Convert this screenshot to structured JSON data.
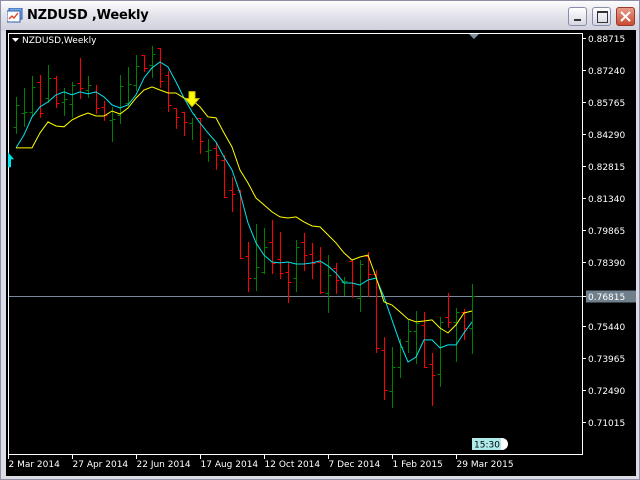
{
  "window": {
    "title": "NZDUSD ,Weekly"
  },
  "chart_header": "NZDUSD,Weekly",
  "timer_label": "15:30",
  "colors": {
    "bull": "#008000",
    "bear": "#ff0000",
    "fast_ma": "#00e5ee",
    "slow_ma": "#ffff00",
    "grid_line": "#778899",
    "background": "#000000",
    "foreground": "#ffffff"
  },
  "chart_data": {
    "type": "bar",
    "subtype": "ohlc",
    "title": "NZDUSD,Weekly",
    "ylim": [
      0.7,
      0.89
    ],
    "y_ticks": [
      "0.88715",
      "0.87240",
      "0.85765",
      "0.84290",
      "0.82815",
      "0.81340",
      "0.79865",
      "0.78390",
      "0.76815",
      "0.75440",
      "0.73965",
      "0.72490",
      "0.71015"
    ],
    "y_tick_values": [
      0.88715,
      0.8724,
      0.85765,
      0.8429,
      0.82815,
      0.8134,
      0.79865,
      0.7839,
      0.76815,
      0.7544,
      0.73965,
      0.7249,
      0.71015
    ],
    "current_price": "0.76815",
    "current_price_value": 0.76815,
    "x_ticks": [
      {
        "label": "2 Mar 2014",
        "bar": -1
      },
      {
        "label": "27 Apr 2014",
        "bar": 7
      },
      {
        "label": "22 Jun 2014",
        "bar": 15
      },
      {
        "label": "17 Aug 2014",
        "bar": 23
      },
      {
        "label": "12 Oct 2014",
        "bar": 31
      },
      {
        "label": "7 Dec 2014",
        "bar": 39
      },
      {
        "label": "1 Feb 2015",
        "bar": 47
      },
      {
        "label": "29 Mar 2015",
        "bar": 55
      }
    ],
    "ohlc": [
      [
        0.8462,
        0.86,
        0.8434,
        0.8563
      ],
      [
        0.8526,
        0.8641,
        0.8466,
        0.8531
      ],
      [
        0.8531,
        0.8697,
        0.8517,
        0.8646
      ],
      [
        0.8669,
        0.8701,
        0.8508,
        0.8526
      ],
      [
        0.8595,
        0.8747,
        0.8577,
        0.8687
      ],
      [
        0.8687,
        0.8697,
        0.8554,
        0.8572
      ],
      [
        0.8577,
        0.8641,
        0.8517,
        0.8591
      ],
      [
        0.8568,
        0.8669,
        0.8508,
        0.8655
      ],
      [
        0.8664,
        0.878,
        0.8595,
        0.8641
      ],
      [
        0.8632,
        0.8697,
        0.86,
        0.8655
      ],
      [
        0.8623,
        0.8655,
        0.8526,
        0.8549
      ],
      [
        0.8554,
        0.8581,
        0.8494,
        0.8517
      ],
      [
        0.8494,
        0.8554,
        0.8397,
        0.8498
      ],
      [
        0.8517,
        0.8701,
        0.848,
        0.8651
      ],
      [
        0.8572,
        0.8738,
        0.8563,
        0.866
      ],
      [
        0.8655,
        0.8793,
        0.8632,
        0.8743
      ],
      [
        0.8793,
        0.8793,
        0.872,
        0.8734
      ],
      [
        0.8747,
        0.8835,
        0.8692,
        0.8798
      ],
      [
        0.8826,
        0.8826,
        0.8646,
        0.8674
      ],
      [
        0.8701,
        0.872,
        0.8535,
        0.8563
      ],
      [
        0.8549,
        0.8549,
        0.8457,
        0.8508
      ],
      [
        0.8531,
        0.8531,
        0.8425,
        0.8485
      ],
      [
        0.848,
        0.8503,
        0.8406,
        0.8521
      ],
      [
        0.8503,
        0.8503,
        0.8342,
        0.8397
      ],
      [
        0.8351,
        0.8406,
        0.8305,
        0.8355
      ],
      [
        0.8365,
        0.8392,
        0.8268,
        0.8332
      ],
      [
        0.8309,
        0.8332,
        0.8139,
        0.8139
      ],
      [
        0.8171,
        0.8231,
        0.8074,
        0.8153
      ],
      [
        0.8171,
        0.8171,
        0.7858,
        0.7858
      ],
      [
        0.7867,
        0.7931,
        0.7705,
        0.7765
      ],
      [
        0.7765,
        0.8014,
        0.771,
        0.7816
      ],
      [
        0.7793,
        0.7996,
        0.7788,
        0.7908
      ],
      [
        0.7931,
        0.8033,
        0.7788,
        0.7835
      ],
      [
        0.7853,
        0.7977,
        0.7765,
        0.7788
      ],
      [
        0.7793,
        0.7839,
        0.7655,
        0.7747
      ],
      [
        0.7765,
        0.7941,
        0.7705,
        0.7908
      ],
      [
        0.7931,
        0.7973,
        0.7802,
        0.7871
      ],
      [
        0.7876,
        0.7927,
        0.7765,
        0.7835
      ],
      [
        0.7839,
        0.7908,
        0.7696,
        0.7701
      ],
      [
        0.7696,
        0.7871,
        0.7609,
        0.7779
      ],
      [
        0.7812,
        0.7835,
        0.7696,
        0.7756
      ],
      [
        0.7747,
        0.777,
        0.7687,
        0.7751
      ],
      [
        0.7844,
        0.7848,
        0.7678,
        0.7742
      ],
      [
        0.7673,
        0.7848,
        0.7613,
        0.783
      ],
      [
        0.7867,
        0.7885,
        0.7682,
        0.7784
      ],
      [
        0.7784,
        0.7802,
        0.7424,
        0.7443
      ],
      [
        0.7433,
        0.7493,
        0.7208,
        0.7249
      ],
      [
        0.7244,
        0.7447,
        0.7171,
        0.7355
      ],
      [
        0.7355,
        0.7484,
        0.7309,
        0.7447
      ],
      [
        0.7475,
        0.7572,
        0.7424,
        0.7521
      ],
      [
        0.7521,
        0.7613,
        0.7374,
        0.7558
      ],
      [
        0.7549,
        0.7609,
        0.7355,
        0.7355
      ],
      [
        0.7369,
        0.742,
        0.718,
        0.7318
      ],
      [
        0.7323,
        0.7586,
        0.7268,
        0.7563
      ],
      [
        0.7586,
        0.7696,
        0.754,
        0.7563
      ],
      [
        0.7563,
        0.7627,
        0.7383,
        0.7609
      ],
      [
        0.7609,
        0.7623,
        0.7484,
        0.7535
      ],
      [
        0.7535,
        0.7738,
        0.742,
        0.7682
      ]
    ],
    "series": [
      {
        "name": "fast_ma",
        "values": [
          0.8365,
          0.8425,
          0.8508,
          0.8554,
          0.8577,
          0.8609,
          0.8623,
          0.8609,
          0.8623,
          0.8614,
          0.8623,
          0.86,
          0.8563,
          0.8549,
          0.8563,
          0.8609,
          0.8687,
          0.8734,
          0.8761,
          0.8738,
          0.8669,
          0.8595,
          0.8531,
          0.848,
          0.8434,
          0.8392,
          0.8323,
          0.8263,
          0.8157,
          0.8019,
          0.7927,
          0.7871,
          0.7839,
          0.7835,
          0.7839,
          0.783,
          0.783,
          0.7835,
          0.7844,
          0.7821,
          0.7788,
          0.7742,
          0.7742,
          0.7733,
          0.7756,
          0.7765,
          0.7678,
          0.7572,
          0.7466,
          0.7378,
          0.7401,
          0.748,
          0.748,
          0.7443,
          0.7457,
          0.7457,
          0.7512,
          0.7563
        ]
      },
      {
        "name": "slow_ma",
        "values": [
          0.8365,
          0.8365,
          0.8365,
          0.8434,
          0.8485,
          0.8466,
          0.8462,
          0.8494,
          0.8512,
          0.8526,
          0.8512,
          0.8512,
          0.8535,
          0.8521,
          0.8549,
          0.8595,
          0.8632,
          0.8646,
          0.8632,
          0.8618,
          0.8618,
          0.8595,
          0.8586,
          0.8554,
          0.8508,
          0.8503,
          0.8434,
          0.8369,
          0.8263,
          0.8203,
          0.8134,
          0.8102,
          0.807,
          0.8047,
          0.8042,
          0.8047,
          0.8024,
          0.8005,
          0.8001,
          0.7964,
          0.7927,
          0.7881,
          0.7848,
          0.7862,
          0.7871,
          0.777,
          0.7655,
          0.7641,
          0.7609,
          0.7576,
          0.7563,
          0.7567,
          0.7572,
          0.7535,
          0.7512,
          0.7549,
          0.7604,
          0.7613
        ]
      }
    ],
    "arrows": [
      {
        "type": "buy",
        "bar": -1,
        "price": 0.8345
      },
      {
        "type": "sell",
        "bar": 22,
        "price": 0.856
      }
    ],
    "grid": false,
    "legend": "none"
  }
}
